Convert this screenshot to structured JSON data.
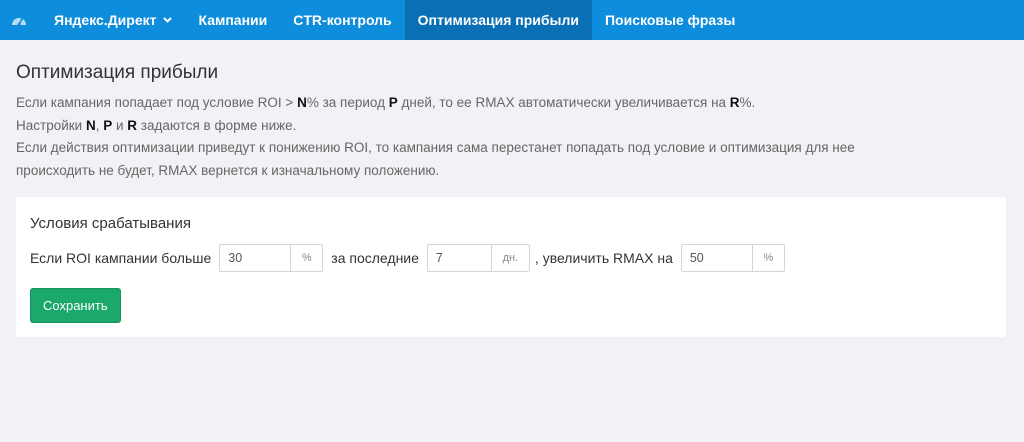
{
  "navbar": {
    "logo_icon": "dashboard-icon",
    "items": [
      {
        "label": "Яндекс.Директ",
        "has_dropdown": true,
        "active": false
      },
      {
        "label": "Кампании",
        "active": false
      },
      {
        "label": "CTR-контроль",
        "active": false
      },
      {
        "label": "Оптимизация прибыли",
        "active": true
      },
      {
        "label": "Поисковые фразы",
        "active": false
      }
    ]
  },
  "page": {
    "title": "Оптимизация прибыли",
    "desc": {
      "l1_a": "Если кампания попадает под условие ROI > ",
      "N": "N",
      "l1_b": "% за период ",
      "P": "P",
      "l1_c": " дней, то ее RMAX автоматически увеличивается на ",
      "R": "R",
      "l1_d": "%.",
      "l2_a": "Настройки ",
      "l2_b": ", ",
      "l2_c": " и ",
      "l2_d": " задаются в форме ниже.",
      "l3": "Если действия оптимизации приведут к понижению ROI, то кампания сама перестанет попадать под условие и оптимизация для нее",
      "l4": "происходить не будет, RMAX вернется к изначальному положению."
    }
  },
  "form": {
    "title": "Условия срабатывания",
    "label_roi": "Если ROI кампании больше",
    "roi_value": "30",
    "roi_unit": "%",
    "label_period": "за последние",
    "period_value": "7",
    "period_unit": "дн.",
    "label_increase": ", увеличить RMAX на",
    "increase_value": "50",
    "increase_unit": "%",
    "save_label": "Сохранить"
  },
  "colors": {
    "navbar": "#0d8ddb",
    "navbar_active": "#0a6fb4",
    "save_button": "#1aa96b",
    "background": "#f1f2f5"
  }
}
